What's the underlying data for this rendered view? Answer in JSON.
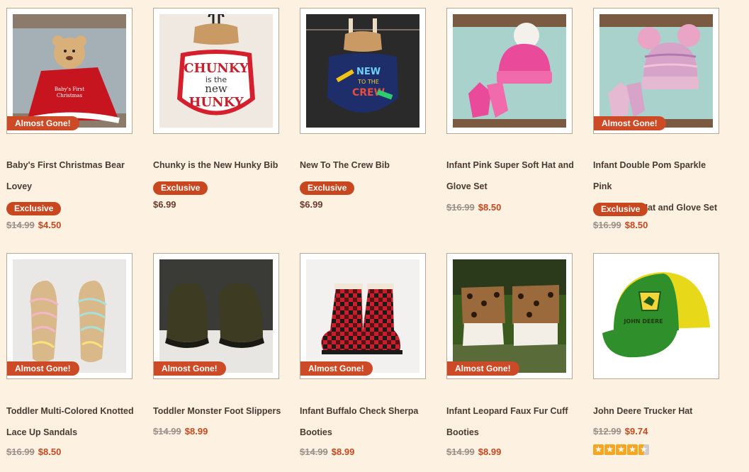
{
  "badges": {
    "almost_gone": "Almost Gone!",
    "exclusive": "Exclusive"
  },
  "products": [
    {
      "title_l1": "Baby's First Christmas Bear",
      "title_l2": "Lovey",
      "exclusive": true,
      "almost_gone": true,
      "old_price": "$14.99",
      "price": "$4.50"
    },
    {
      "title_l1": "Chunky is the New Hunky Bib",
      "title_l2": "",
      "exclusive": true,
      "almost_gone": false,
      "old_price": "",
      "price": "$6.99"
    },
    {
      "title_l1": "New To The Crew Bib",
      "title_l2": "",
      "exclusive": true,
      "almost_gone": false,
      "old_price": "",
      "price": "$6.99"
    },
    {
      "title_l1": "Infant Pink Super Soft Hat and",
      "title_l2": "Glove Set",
      "exclusive": false,
      "almost_gone": false,
      "old_price": "$16.99",
      "price": "$8.50"
    },
    {
      "title_l1": "Infant Double Pom Sparkle Pink",
      "title_l2": "and Purple Hat and Glove Set",
      "exclusive": true,
      "almost_gone": true,
      "old_price": "$16.99",
      "price": "$8.50"
    },
    {
      "title_l1": "Toddler Multi-Colored Knotted",
      "title_l2": "Lace Up Sandals",
      "exclusive": false,
      "almost_gone": true,
      "old_price": "$16.99",
      "price": "$8.50"
    },
    {
      "title_l1": "Toddler Monster Foot Slippers",
      "title_l2": "",
      "exclusive": false,
      "almost_gone": true,
      "old_price": "$14.99",
      "price": "$8.99"
    },
    {
      "title_l1": "Infant Buffalo Check Sherpa",
      "title_l2": "Booties",
      "exclusive": false,
      "almost_gone": true,
      "old_price": "$14.99",
      "price": "$8.99"
    },
    {
      "title_l1": "Infant Leopard Faux Fur Cuff",
      "title_l2": "Booties",
      "exclusive": false,
      "almost_gone": true,
      "old_price": "$14.99",
      "price": "$8.99"
    },
    {
      "title_l1": "John Deere Trucker Hat",
      "title_l2": "",
      "exclusive": false,
      "almost_gone": false,
      "old_price": "$12.99",
      "price": "$9.74",
      "rating": 4.5
    }
  ],
  "image_text": {
    "chunky": [
      "CHUNKY",
      "is the",
      "new",
      "HUNKY"
    ],
    "crew": [
      "NEW",
      "TO THE",
      "CREW"
    ],
    "deere": "JOHN DEERE"
  },
  "colors": {
    "background": "#fdf1e1",
    "accent": "#c9471f",
    "title": "#4a3a32",
    "star": "#f5a623"
  }
}
